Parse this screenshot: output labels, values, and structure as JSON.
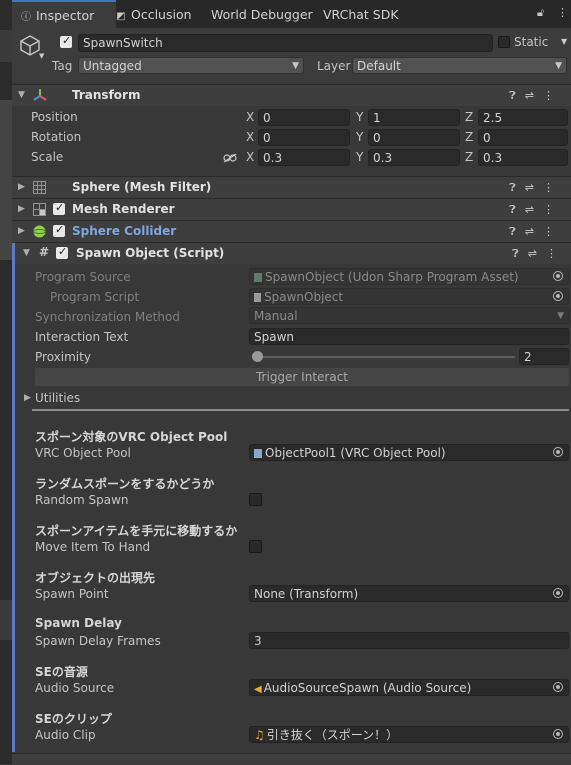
{
  "tabs": [
    {
      "label": "Inspector",
      "icon": "info-icon"
    },
    {
      "label": "Occlusion",
      "icon": "occlusion-icon"
    },
    {
      "label": "World Debugger",
      "icon": ""
    },
    {
      "label": "VRChat SDK",
      "icon": ""
    }
  ],
  "object": {
    "name": "SpawnSwitch",
    "active": true,
    "static_label": "Static",
    "static_checked": false,
    "tag_label": "Tag",
    "tag_value": "Untagged",
    "layer_label": "Layer",
    "layer_value": "Default"
  },
  "transform": {
    "title": "Transform",
    "position_label": "Position",
    "rotation_label": "Rotation",
    "scale_label": "Scale",
    "axis_x": "X",
    "axis_y": "Y",
    "axis_z": "Z",
    "position": {
      "x": "0",
      "y": "1",
      "z": "2.5"
    },
    "rotation": {
      "x": "0",
      "y": "0",
      "z": "0"
    },
    "scale": {
      "x": "0.3",
      "y": "0.3",
      "z": "0.3"
    }
  },
  "components": {
    "mesh_filter": "Sphere (Mesh Filter)",
    "mesh_renderer": "Mesh Renderer",
    "sphere_collider": "Sphere Collider",
    "script": "Spawn Object (Script)"
  },
  "udon": {
    "program_source_label": "Program Source",
    "program_source_value": "SpawnObject (Udon Sharp Program Asset)",
    "program_script_label": "Program Script",
    "program_script_value": "SpawnObject",
    "sync_label": "Synchronization Method",
    "sync_value": "Manual",
    "interaction_label": "Interaction Text",
    "interaction_value": "Spawn",
    "proximity_label": "Proximity",
    "proximity_value": "2",
    "proximity_level": 0.0,
    "trigger_button": "Trigger Interact",
    "utilities_label": "Utilities"
  },
  "fields": {
    "pool_header": "スポーン対象のVRC Object Pool",
    "pool_label": "VRC Object Pool",
    "pool_value": "ObjectPool1 (VRC Object Pool)",
    "random_header": "ランダムスポーンをするかどうか",
    "random_label": "Random Spawn",
    "random_checked": false,
    "move_header": "スポーンアイテムを手元に移動するか",
    "move_label": "Move Item To Hand",
    "move_checked": false,
    "point_header": "オブジェクトの出現先",
    "point_label": "Spawn Point",
    "point_value": "None (Transform)",
    "delay_header": "Spawn Delay",
    "delay_label": "Spawn Delay Frames",
    "delay_value": "3",
    "se_source_header": "SEの音源",
    "se_source_label": "Audio Source",
    "se_source_value": "AudioSourceSpawn (Audio Source)",
    "se_clip_header": "SEのクリップ",
    "se_clip_label": "Audio Clip",
    "se_clip_value": "引き抜く（スポーン！）"
  },
  "colors": {
    "accent": "#3a79bb",
    "collider_title": "#7ea6e0",
    "script_bar": "#5b7bc6"
  }
}
